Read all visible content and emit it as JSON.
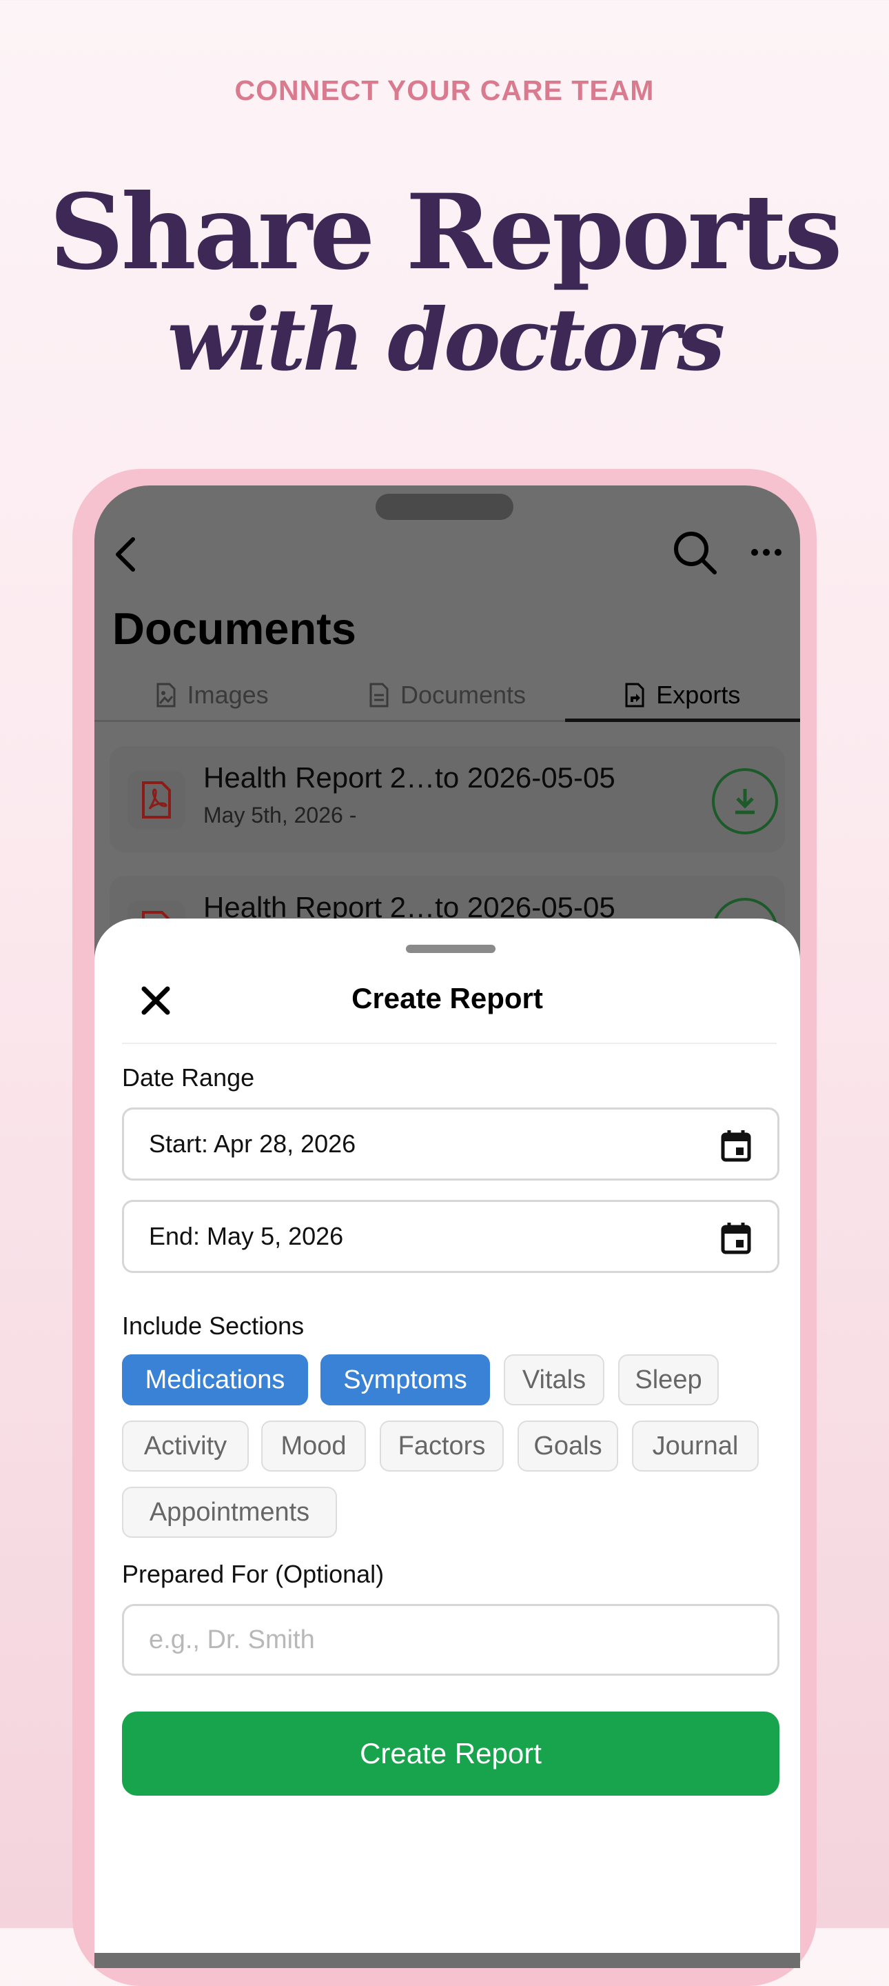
{
  "hero": {
    "eyebrow": "CONNECT YOUR CARE TEAM",
    "headline": "Share Reports",
    "subline": "with doctors"
  },
  "app": {
    "page_title": "Documents",
    "tabs": [
      {
        "label": "Images",
        "icon": "image-file-icon",
        "active": false
      },
      {
        "label": "Documents",
        "icon": "document-file-icon",
        "active": false
      },
      {
        "label": "Exports",
        "icon": "export-file-icon",
        "active": true
      }
    ],
    "documents": [
      {
        "title": "Health Report 2…to 2026-05-05",
        "date": "May 5th, 2026 -",
        "icon": "pdf-icon"
      },
      {
        "title": "Health Report 2…to 2026-05-05",
        "date": "",
        "icon": "pdf-icon"
      }
    ]
  },
  "sheet": {
    "title": "Create Report",
    "date_range_label": "Date Range",
    "start_value": "Start: Apr 28, 2026",
    "end_value": "End: May 5, 2026",
    "sections_label": "Include Sections",
    "chips": [
      {
        "label": "Medications",
        "selected": true
      },
      {
        "label": "Symptoms",
        "selected": true
      },
      {
        "label": "Vitals",
        "selected": false
      },
      {
        "label": "Sleep",
        "selected": false
      },
      {
        "label": "Activity",
        "selected": false
      },
      {
        "label": "Mood",
        "selected": false
      },
      {
        "label": "Factors",
        "selected": false
      },
      {
        "label": "Goals",
        "selected": false
      },
      {
        "label": "Journal",
        "selected": false
      },
      {
        "label": "Appointments",
        "selected": false
      }
    ],
    "prepared_for_label": "Prepared For (Optional)",
    "prepared_for_value": "",
    "prepared_for_placeholder": "e.g., Dr. Smith",
    "submit_label": "Create Report"
  },
  "colors": {
    "accent_pink": "#d97a8f",
    "headline_purple": "#3d2856",
    "chip_selected": "#3a82d6",
    "primary_green": "#18a44c",
    "download_green": "#1c5a2a",
    "pdf_red": "#b3261e"
  }
}
